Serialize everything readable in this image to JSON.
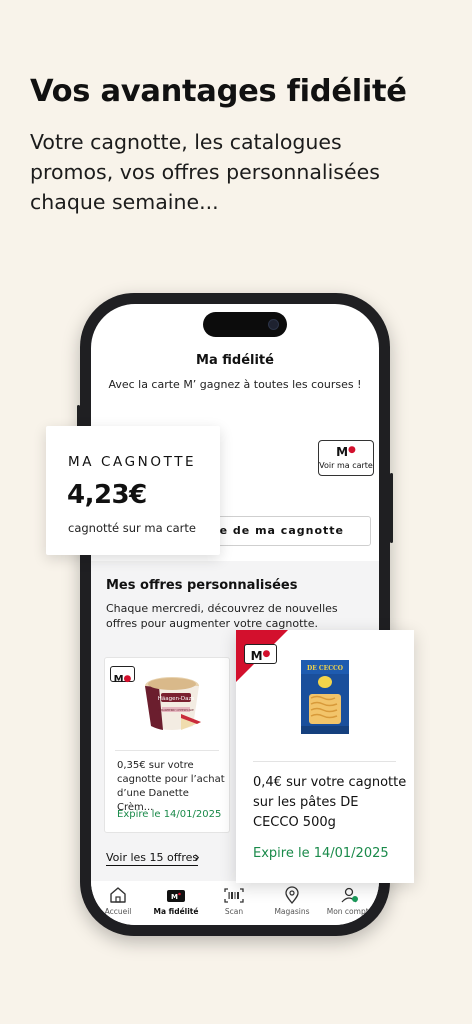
{
  "hero": {
    "title": "Vos avantages fidélité",
    "subtitle": "Votre cagnotte, les catalogues promos, vos offres personnalisées chaque semaine..."
  },
  "screen": {
    "title": "Ma fidélité",
    "subtitle": "Avec la carte M’ gagnez à toutes les courses !",
    "card_button": {
      "logo": "M",
      "label": "Voir ma carte"
    },
    "history_button_label": "ue de ma cagnotte",
    "offers": {
      "title": "Mes offres personnalisées",
      "description": "Chaque mercredi, découvrez de nouvelles offres pour augmenter votre cagnotte.",
      "items": [
        {
          "badge": "M",
          "product_brand": "Häagen-Dazs",
          "product_flavor": "STRAWBERRY CHEESECAKE",
          "text": "0,35€ sur votre cagnotte pour l’achat d’une Danette Crèm...",
          "expiry": "Expire le 14/01/2025"
        }
      ],
      "see_all": "Voir les 15 offres"
    },
    "tabs": [
      {
        "label": "Accueil",
        "icon": "home-icon"
      },
      {
        "label": "Ma fidélité",
        "icon": "loyalty-card-icon"
      },
      {
        "label": "Scan",
        "icon": "barcode-icon"
      },
      {
        "label": "Magasins",
        "icon": "location-pin-icon"
      },
      {
        "label": "Mon compte",
        "icon": "user-icon"
      }
    ]
  },
  "cagnotte": {
    "title": "MA CAGNOTTE",
    "amount": "4,23€",
    "note": "cagnotté sur ma carte"
  },
  "featured_offer": {
    "badge": "M",
    "product_brand": "DE CECCO",
    "text": "0,4€ sur votre cagnotte sur les pâtes DE CECCO 500g",
    "expiry": "Expire le 14/01/2025"
  },
  "colors": {
    "background": "#f8f3ea",
    "brand_red": "#d3102d",
    "expiry_green": "#1a8a4a",
    "phone_frame": "#1f1f22"
  }
}
